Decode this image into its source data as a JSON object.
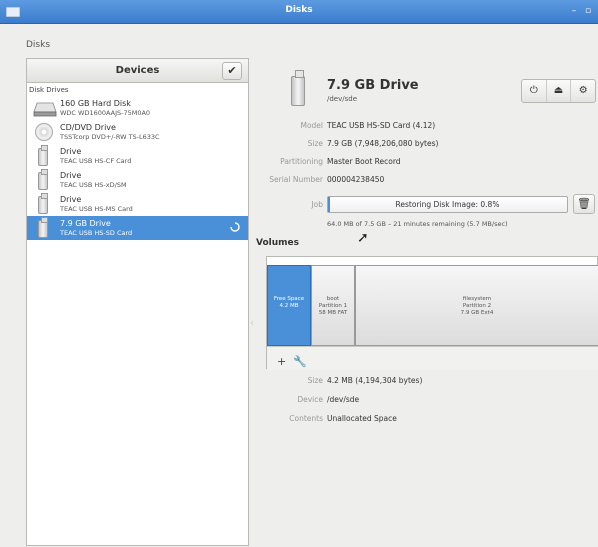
{
  "window": {
    "title": "Disks"
  },
  "frame_label": "Disks",
  "devices_panel": {
    "title": "Devices",
    "section_label": "Disk Drives",
    "devices": [
      {
        "name": "160 GB Hard Disk",
        "sub": "WDC WD1600AAJS-75M0A0",
        "icon": "hard-disk-icon"
      },
      {
        "name": "CD/DVD Drive",
        "sub": "TSSTcorp DVD+/-RW TS-L633C",
        "icon": "optical-disc-icon"
      },
      {
        "name": "Drive",
        "sub": "TEAC USB   HS-CF Card",
        "icon": "usb-drive-icon"
      },
      {
        "name": "Drive",
        "sub": "TEAC USB   HS-xD/SM",
        "icon": "usb-drive-icon"
      },
      {
        "name": "Drive",
        "sub": "TEAC USB   HS-MS Card",
        "icon": "usb-drive-icon"
      },
      {
        "name": "7.9 GB Drive",
        "sub": "TEAC USB   HS-SD Card",
        "icon": "usb-drive-icon",
        "selected": true
      }
    ]
  },
  "drive": {
    "title": "7.9 GB Drive",
    "path": "/dev/sde",
    "properties": [
      {
        "key": "Model",
        "value": "TEAC USB   HS-SD Card (4.12)"
      },
      {
        "key": "Size",
        "value": "7.9 GB (7,948,206,080 bytes)"
      },
      {
        "key": "Partitioning",
        "value": "Master Boot Record"
      },
      {
        "key": "Serial Number",
        "value": "000004238450"
      }
    ],
    "job": {
      "label": "Job",
      "text": "Restoring Disk Image: 0.8%",
      "progress": 0.008,
      "sub": "64.0 MB of 7.5 GB – 21 minutes remaining (5.7 MB/sec)"
    }
  },
  "volumes": {
    "title": "Volumes",
    "partitions": [
      {
        "line1": "Free Space",
        "line2": "4.2 MB",
        "line3": ""
      },
      {
        "line1": "boot",
        "line2": "Partition 1",
        "line3": "58 MB FAT"
      },
      {
        "line1": "filesystem",
        "line2": "Partition 2",
        "line3": "7.9 GB Ext4"
      }
    ],
    "details": [
      {
        "key": "Size",
        "value": "4.2 MB (4,194,304 bytes)"
      },
      {
        "key": "Device",
        "value": "/dev/sde"
      },
      {
        "key": "Contents",
        "value": "Unallocated Space"
      }
    ]
  },
  "colors": {
    "accent": "#4a90d9",
    "titlebar": "#3c7ccd"
  }
}
